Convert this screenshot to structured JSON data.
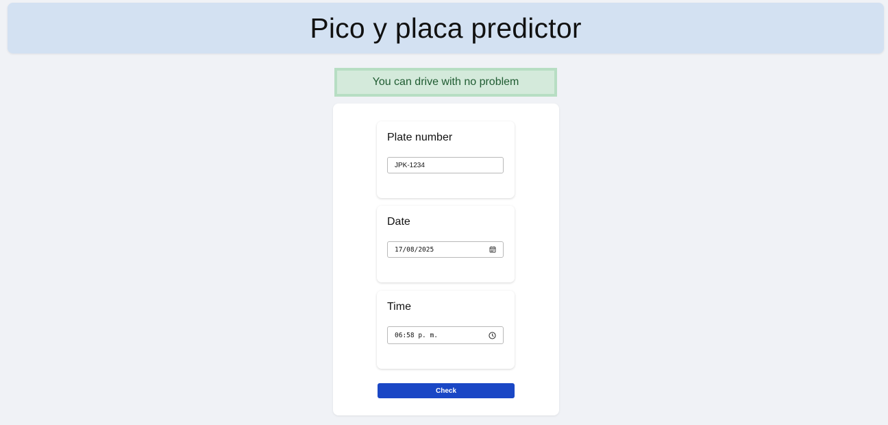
{
  "header": {
    "title": "Pico y placa predictor"
  },
  "alert": {
    "message": "You can drive with no problem"
  },
  "form": {
    "plate": {
      "label": "Plate number",
      "value": "JPK-1234"
    },
    "date": {
      "label": "Date",
      "value": "17/08/2025",
      "icon": "calendar-icon"
    },
    "time": {
      "label": "Time",
      "value": "06:58 p. m.",
      "icon": "clock-icon"
    },
    "submit_label": "Check"
  },
  "colors": {
    "background": "#f0f2f6",
    "header_bg": "#d3e1f2",
    "alert_bg": "#d4eadb",
    "alert_border": "#b7dec3",
    "alert_text": "#1f5b31",
    "button_bg": "#1a47c5"
  }
}
